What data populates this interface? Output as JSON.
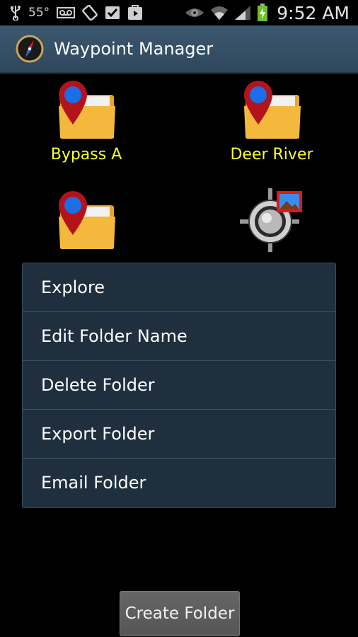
{
  "status_bar": {
    "temperature": "55°",
    "time": "9:52 AM",
    "icons": [
      "usb-icon",
      "voicemail-icon",
      "rotation-icon",
      "check-icon",
      "play-store-icon",
      "eye-icon",
      "wifi-icon",
      "signal-icon",
      "battery-charging-icon"
    ]
  },
  "action_bar": {
    "title": "Waypoint Manager",
    "icon": "compass-icon"
  },
  "folders": [
    {
      "label": "Bypass A",
      "icon": "waypoint-folder-icon"
    },
    {
      "label": "Deer River",
      "icon": "waypoint-folder-icon"
    },
    {
      "label": "",
      "icon": "waypoint-folder-icon"
    },
    {
      "label": "",
      "icon": "crosshair-image-icon"
    }
  ],
  "context_menu": {
    "items": [
      "Explore",
      "Edit Folder Name",
      "Delete Folder",
      "Export Folder",
      "Email Folder"
    ]
  },
  "create_folder_button": "Create Folder",
  "colors": {
    "action_bar": "#34506a",
    "label_yellow": "#ffff2a",
    "menu_bg": "#1f2f3e"
  }
}
